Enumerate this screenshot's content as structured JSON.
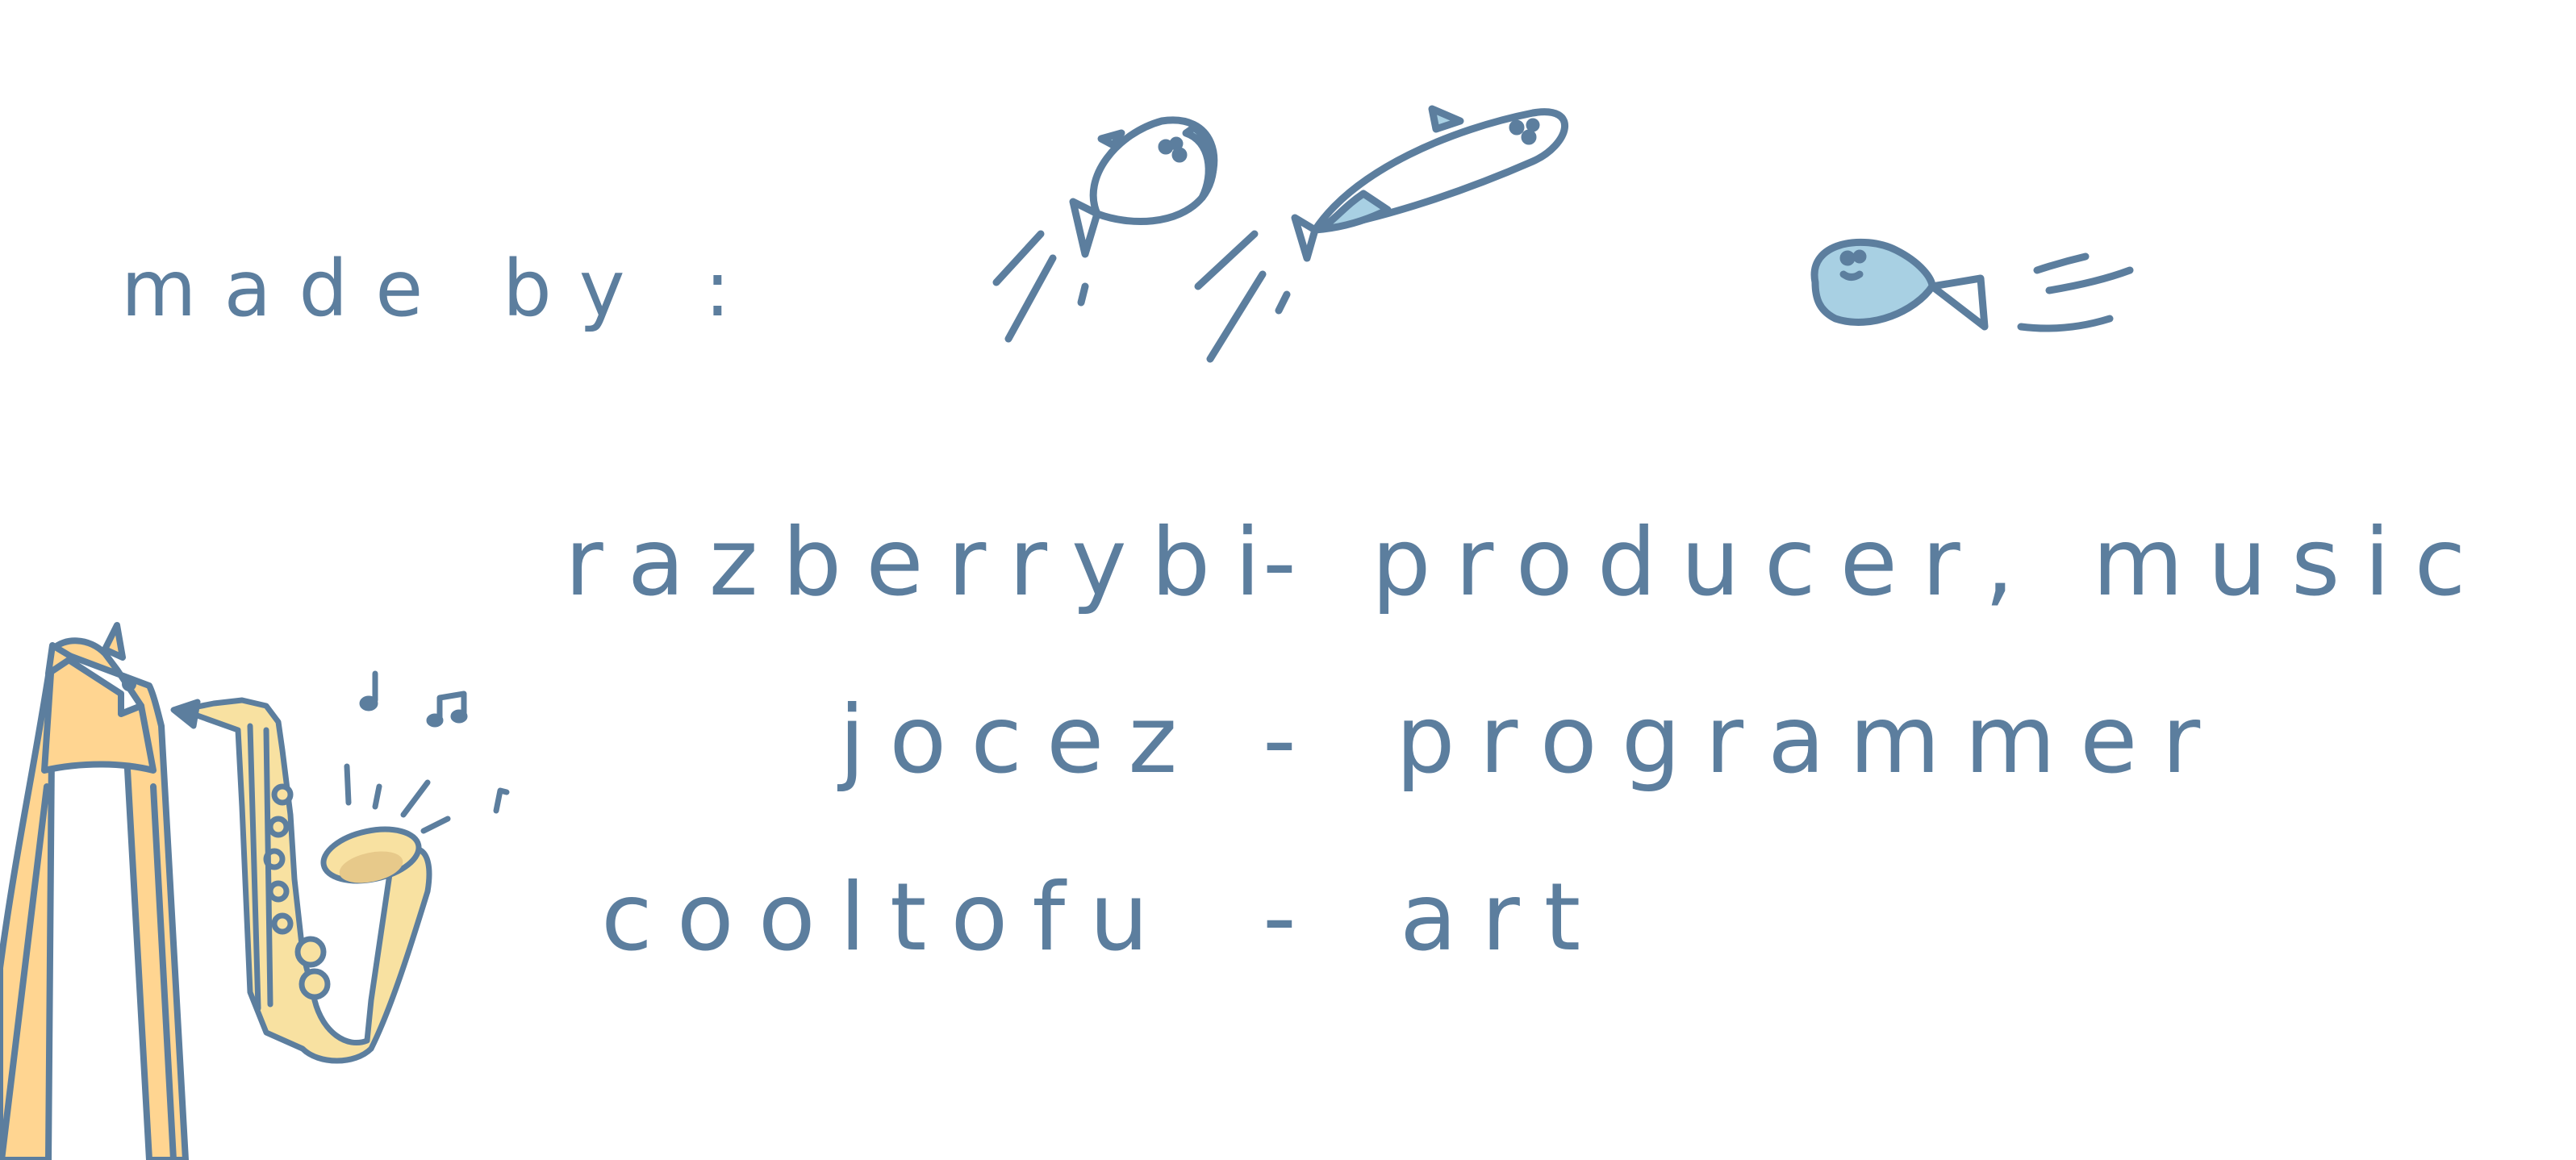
{
  "heading": "made by :",
  "credits": [
    {
      "name": "razberrybi",
      "dash": "-",
      "role": "producer, music"
    },
    {
      "name": "jocez",
      "dash": "-",
      "role": "programmer"
    },
    {
      "name": "cooltofu",
      "dash": "-",
      "role": "art"
    }
  ],
  "illustrations": {
    "fish_icon_1": "jumping-fish-icon",
    "fish_icon_2": "leaping-long-fish-icon",
    "fish_icon_3": "swimming-fish-icon",
    "saxophone_icon": "saxophone-icon",
    "cat_icon": "cat-icon",
    "music_notes_icon": "music-notes-icon"
  },
  "colors": {
    "ink": "#5c7e9e",
    "fish_fill": "#a8d0e3",
    "cat_fill": "#ffd591",
    "sax_fill": "#f8e1a1",
    "background": "#ffffff"
  }
}
